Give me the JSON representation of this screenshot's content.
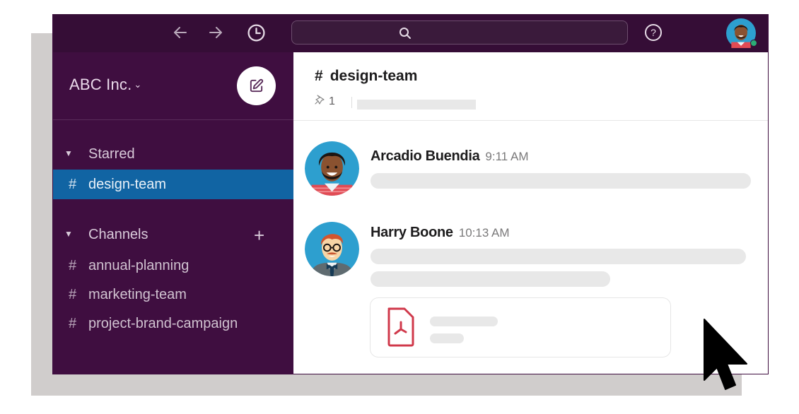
{
  "colors": {
    "topbar": "#350d36",
    "sidebar": "#3f0e40",
    "active_channel": "#1164a3",
    "pdf_red": "#d0394b",
    "presence": "#2bac76"
  },
  "topbar": {
    "icons": [
      "back-arrow-icon",
      "forward-arrow-icon",
      "history-clock-icon",
      "search-icon",
      "help-icon"
    ],
    "search_placeholder": "",
    "user_avatar": "user-avatar"
  },
  "sidebar": {
    "workspace_name": "ABC Inc.",
    "workspace_chevron": "⌄",
    "compose_icon": "compose-icon",
    "sections": [
      {
        "label": "Starred",
        "collapse_glyph": "▼",
        "channels": [
          {
            "hash": "#",
            "name": "design-team",
            "active": true
          }
        ]
      },
      {
        "label": "Channels",
        "collapse_glyph": "▼",
        "add_glyph": "+",
        "channels": [
          {
            "hash": "#",
            "name": "annual-planning",
            "active": false
          },
          {
            "hash": "#",
            "name": "marketing-team",
            "active": false
          },
          {
            "hash": "#",
            "name": "project-brand-campaign",
            "active": false
          }
        ]
      }
    ]
  },
  "channel": {
    "hash": "#",
    "name": "design-team",
    "pinned_count": "1"
  },
  "messages": [
    {
      "author": "Arcadio Buendia",
      "time": "9:11 AM",
      "avatar": "arcadio-avatar"
    },
    {
      "author": "Harry Boone",
      "time": "10:13 AM",
      "avatar": "harry-avatar",
      "attachment": {
        "type": "pdf",
        "icon": "pdf-file-icon"
      }
    }
  ],
  "pointer": "mouse-pointer-cursor"
}
